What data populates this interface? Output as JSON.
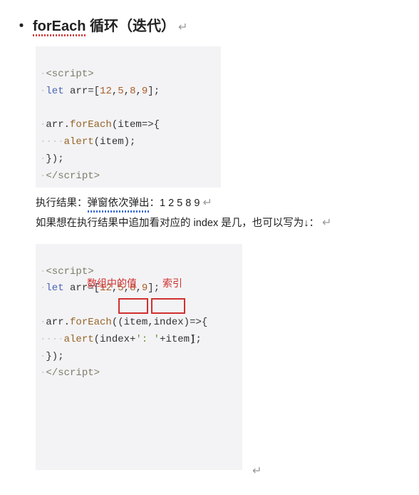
{
  "heading": {
    "bullet": "・",
    "title": "forEach",
    "rest": " 循环（迭代）",
    "carriage": "↵"
  },
  "code1": {
    "l1a": "·",
    "l1b": "<script>",
    "l2a": "·",
    "l2b": "let",
    "l2c": " arr=[",
    "l2d": "12",
    "l2e": ",",
    "l2f": "5",
    "l2g": ",",
    "l2h": "8",
    "l2i": ",",
    "l2j": "9",
    "l2k": "];",
    "l3": "",
    "l4a": "·",
    "l4b": "arr.",
    "l4c": "forEach",
    "l4d": "(item=>{",
    "l5a": "····",
    "l5b": "alert",
    "l5c": "(item);",
    "l6a": "·",
    "l6b": "});",
    "l7a": "·",
    "l7b": "</script>"
  },
  "text1a": "执行结果：",
  "text1b": "弹窗依次弹出",
  "text1c": "：1 2 5 8 9",
  "text1d": "↵",
  "text2": "如果想在执行结果中追加看对应的 index 是几，也可以写为↓：",
  "text2end": "↵",
  "code2": {
    "l1a": "·",
    "l1b": "<script>",
    "l2a": "·",
    "l2b": "let",
    "l2c": " arr=[",
    "l2d": "12",
    "l2e": ",",
    "l2f": "5",
    "l2g": ",",
    "l2h": "8",
    "l2i": ",",
    "l2j": "9",
    "l2k": "];",
    "l3": "",
    "l4a": "·",
    "l4b": "arr.",
    "l4c": "forEach",
    "l4d": "((",
    "l4e": "item",
    "l4f": ",",
    "l4g": "index",
    "l4h": ")=>{",
    "l5a": "····",
    "l5b": "alert",
    "l5c": "(index+",
    "l5d": "': '",
    "l5e": "+item);",
    "l6a": "·",
    "l6b": "});",
    "l7a": "·",
    "l7b": "</script>"
  },
  "annot1": "数组中的值",
  "annot2": "索引",
  "cursor": "I",
  "trail": "↵"
}
